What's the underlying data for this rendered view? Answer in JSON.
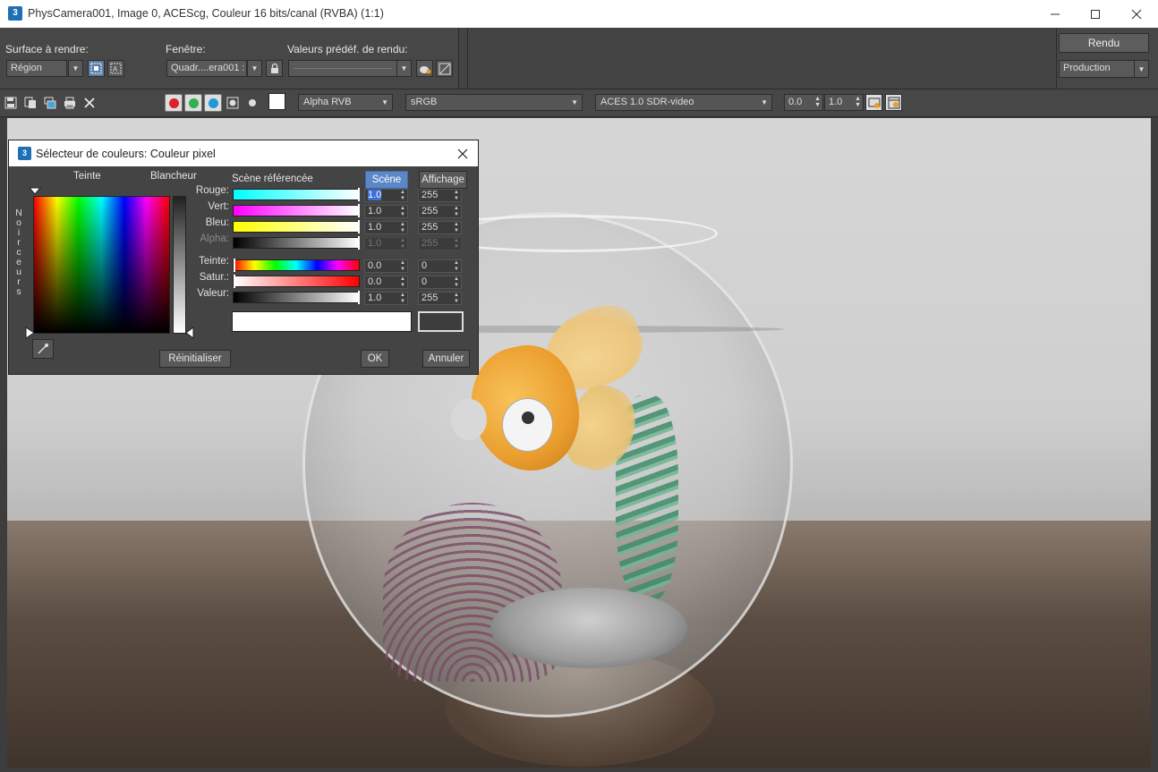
{
  "window": {
    "title": "PhysCamera001, Image 0, ACEScg, Couleur 16 bits/canal (RVBA) (1:1)",
    "app_icon_text": "3",
    "minimize_icon": "minimize-icon",
    "maximize_icon": "maximize-icon",
    "close_icon": "close-icon"
  },
  "top_panel": {
    "surface_label": "Surface à rendre:",
    "surface_value": "Région",
    "window_label": "Fenêtre:",
    "window_value": "Quadr....era001 :",
    "presets_label": "Valeurs prédéf. de rendu:",
    "presets_value": "",
    "render_button": "Rendu",
    "production_value": "Production"
  },
  "toolbar": {
    "channel_dd": "Alpha RVB",
    "colorspace_dd": "sRGB",
    "view_transform_dd": "ACES 1.0 SDR-video",
    "exposure_value": "0.0",
    "gamma_value": "1.0",
    "channel_colors": {
      "red": "#e0202a",
      "green": "#2db34a",
      "blue": "#1f9ad6"
    }
  },
  "dialog": {
    "title": "Sélecteur de couleurs: Couleur pixel",
    "hue_label": "Teinte",
    "whiteness_label": "Blancheur",
    "blackness_label": "Noirceurs",
    "scene_ref_label": "Scène référencée",
    "tab_scene": "Scène",
    "tab_display": "Affichage",
    "rows": [
      {
        "label": "Rouge:",
        "scene": "1.0",
        "display": "255"
      },
      {
        "label": "Vert:",
        "scene": "1.0",
        "display": "255"
      },
      {
        "label": "Bleu:",
        "scene": "1.0",
        "display": "255"
      },
      {
        "label": "Alpha:",
        "scene": "1.0",
        "display": "255"
      },
      {
        "label": "Teinte:",
        "scene": "0.0",
        "display": "0"
      },
      {
        "label": "Satur.:",
        "scene": "0.0",
        "display": "0"
      },
      {
        "label": "Valeur:",
        "scene": "1.0",
        "display": "255"
      }
    ],
    "reset_button": "Réinitialiser",
    "ok_button": "OK",
    "cancel_button": "Annuler"
  }
}
